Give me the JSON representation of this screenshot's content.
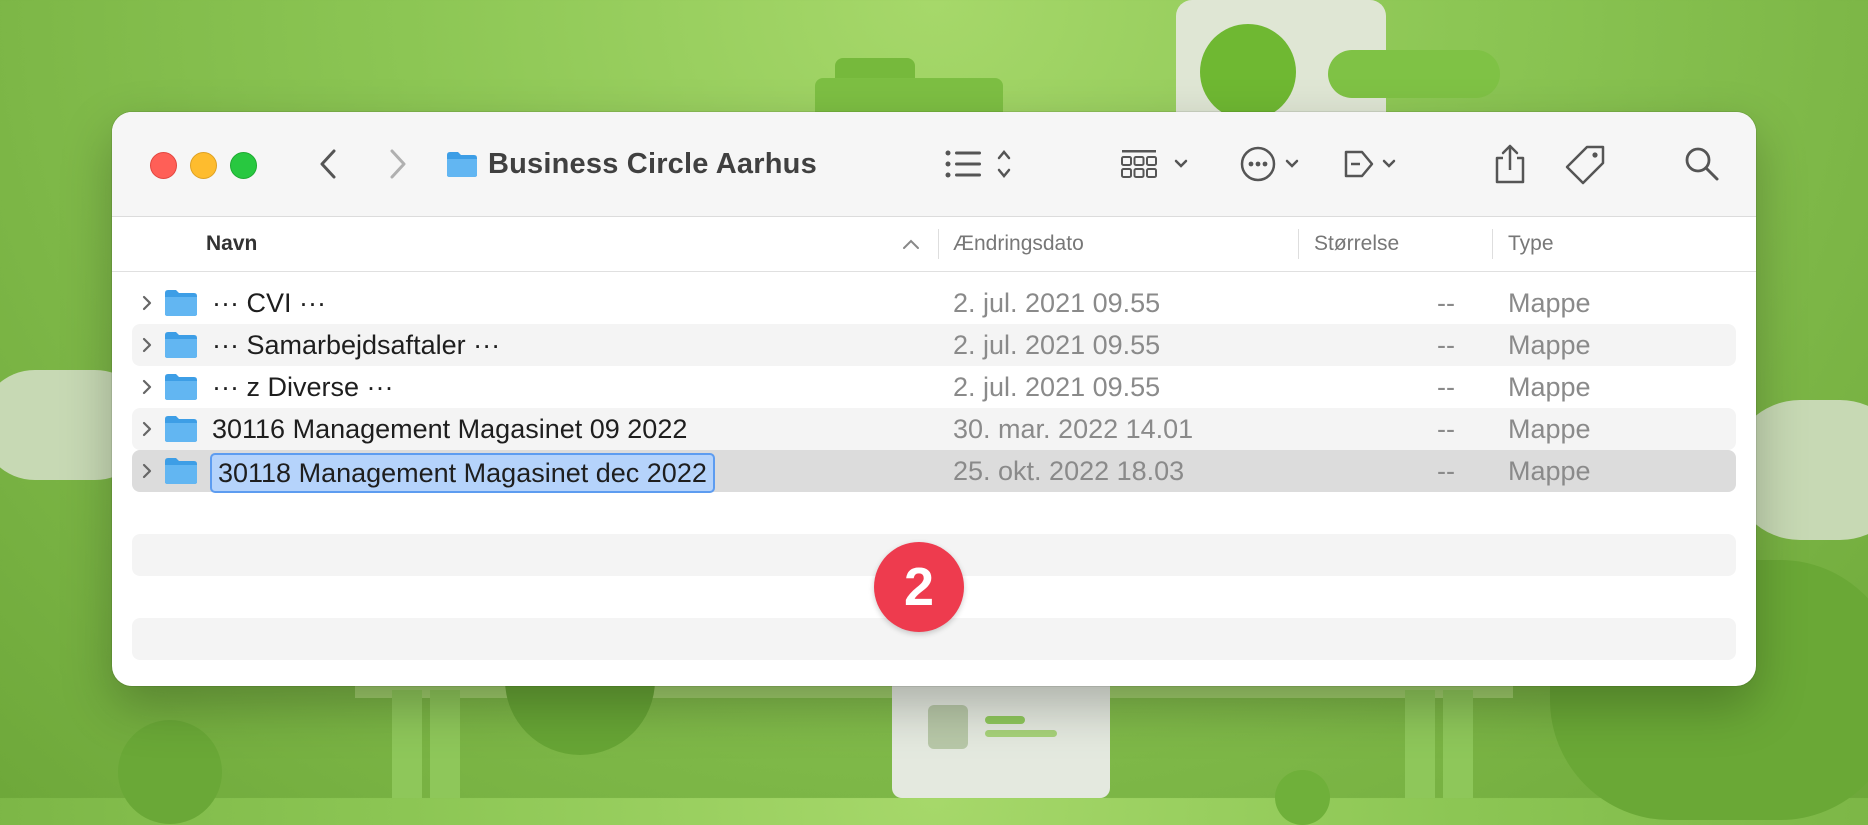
{
  "window": {
    "title": "Business Circle Aarhus"
  },
  "columns": {
    "name": "Navn",
    "date": "Ændringsdato",
    "size": "Størrelse",
    "type": "Type"
  },
  "rows": [
    {
      "name": "··· CVI ···",
      "date": "2. jul. 2021 09.55",
      "size": "--",
      "type": "Mappe"
    },
    {
      "name": "··· Samarbejdsaftaler ···",
      "date": "2. jul. 2021 09.55",
      "size": "--",
      "type": "Mappe"
    },
    {
      "name": "··· z Diverse ···",
      "date": "2. jul. 2021 09.55",
      "size": "--",
      "type": "Mappe"
    },
    {
      "name": "30116 Management Magasinet 09 2022",
      "date": "30. mar. 2022 14.01",
      "size": "--",
      "type": "Mappe"
    },
    {
      "name": "30118 Management Magasinet dec 2022",
      "date": "25. okt. 2022 18.03",
      "size": "--",
      "type": "Mappe"
    }
  ],
  "step_badge": "2",
  "colors": {
    "folder": "#5ab0ee",
    "selection_edit": "#b5d3fb",
    "badge": "#ee3b4e"
  },
  "icons": [
    "back-icon",
    "forward-icon",
    "list-view-icon",
    "grid-view-icon",
    "more-icon",
    "tag-action-icon",
    "share-icon",
    "tag-icon",
    "search-icon"
  ]
}
